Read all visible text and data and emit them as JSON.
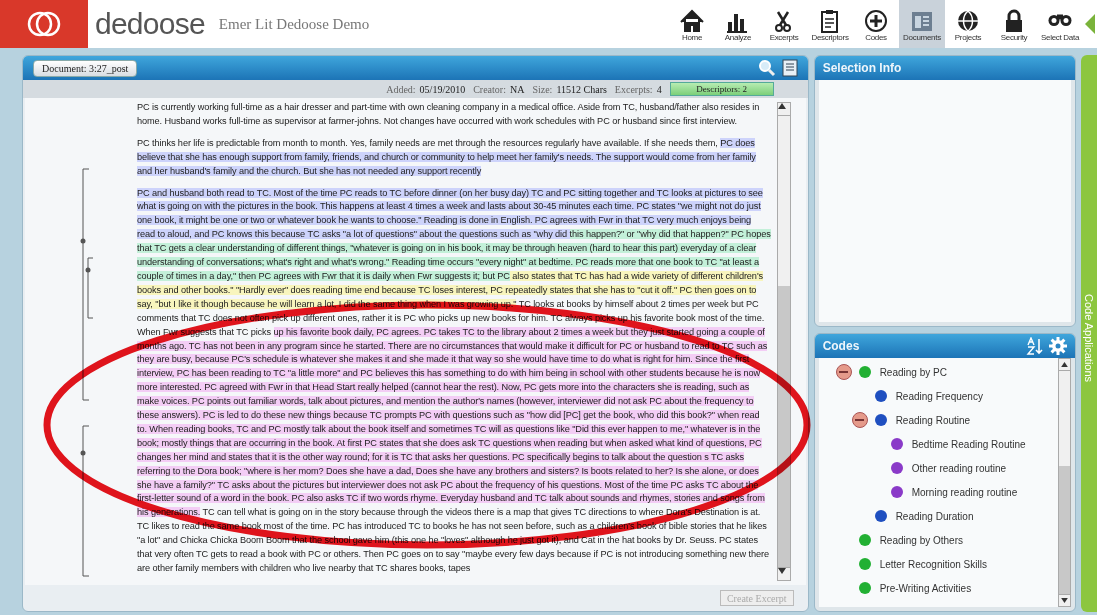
{
  "header": {
    "brand": "dedoose",
    "project": "Emer Lit Dedoose Demo",
    "toolbar": [
      {
        "label": "Home",
        "selected": false
      },
      {
        "label": "Analyze",
        "selected": false
      },
      {
        "label": "Excerpts",
        "selected": false
      },
      {
        "label": "Descriptors",
        "selected": false
      },
      {
        "label": "Codes",
        "selected": false
      },
      {
        "label": "Documents",
        "selected": true
      },
      {
        "label": "Projects",
        "selected": false
      },
      {
        "label": "Security",
        "selected": false
      },
      {
        "label": "Select Data",
        "selected": false
      }
    ]
  },
  "document": {
    "title_button": "Document: 3:27_post",
    "meta": [
      {
        "label": "Added:",
        "value": "05/19/2010"
      },
      {
        "label": "Creator:",
        "value": "NA"
      },
      {
        "label": "Size:",
        "value": "11512 Chars"
      },
      {
        "label": "Excerpts:",
        "value": "4"
      }
    ],
    "descriptors_button": "Descriptors: 2",
    "paragraphs": [
      {
        "runs": [
          {
            "text": "PC is currently working full-time as a hair dresser and part-time with own cleaning company in a medical office.  Aside from TC, husband/father also resides in home.  Husband works full-time as supervisor at farmer-johns.  Not changes have occurred with work schedules with PC or husband since first interview."
          }
        ]
      },
      {
        "runs": [
          {
            "text": "PC thinks her life is predictable from month to month.  Yes, family needs are met through the resources regularly have available.  If she needs them, "
          },
          {
            "text": "PC does believe that she has enough support from family, friends, and church or community to help meet her family's needs.  The support would come from her family and her husband's family and the church.  But she has not needed any support recently",
            "color": "#cdd3fb"
          }
        ]
      },
      {
        "runs": [
          {
            "text": "PC and husband both read to TC.  Most of the time PC reads to TC before dinner (on her busy day) TC and PC sitting together and TC looks at pictures to see what is going on with the pictures in the book.  This happens at least 4 times a week and lasts about 30-45 minutes each time. PC states \"we might not do just one book, it might be one or two or whatever book he wants to choose.\"  Reading is done in English.  PC agrees with Fwr in that TC very much enjoys being read to aloud, and PC knows this because TC asks \"a lot of questions\" about the questions such as \"why did ",
            "color": "#cdd3fb"
          },
          {
            "text": "this happen?\" or \"why did that happen?\"  PC hopes that TC gets a clear understanding of different things, \"whatever is going on in his book, it may be through heaven (hard to hear this part) everyday of a clear understanding of conversations; what's right and what's wrong.\"  Reading time occurs \"every night\" at bedtime.  PC reads more that one book to TC \"at least a couple of times in a day,\" then PC agrees with Fwr that it is daily when Fwr suggests it; but PC",
            "color": "#c3f0d9"
          },
          {
            "text": " also states that TC has had a wide variety of different children's books and other books.\"  \"Hardly ever\" does reading time end because TC loses interest, PC repeatedly states that she has to \"cut it off.\"  PC then goes on to say, \"but I like it though because he will learn a lot, I did the same thing when I was growing up.\"",
            "color": "#f8f5bd"
          },
          {
            "text": "  TC looks at books by himself about 2 times per week but PC comments that TC does not often pick up different ones, rather it is PC who picks up new books for him.  TC always picks up his favorite book most of the time.  When Fwr suggests that TC picks "
          },
          {
            "text": "up his favorite book daily, PC agrees.  PC takes TC to the library about 2 times a week but they just started going a couple of months ago.  TC has not been in any program since he started.  There are no circumstances that would make it difficult for PC or husband to read to TC such as they are busy, because PC's schedule is whatever she makes it and she made it that way so she would have time to do what is right for him.  Since the first interview, PC has been reading to TC \"a little more\" and PC believes this has something to do with him being in school with other students because he is now more interested. PC agreed with Fwr in that Head Start really helped (cannot hear the rest). Now, PC gets more into the characters she is reading, such as make voices.  PC points out familiar words, talk about pictures, and mention the author's names (however, interviewer did not ask PC about the frequency to these answers).  PC is led to do these new things because TC prompts PC with questions such as \"how did [PC] get the book, who did this book?\" when read to.  When reading books, TC and PC mostly talk about the book itself and sometimes TC will as questions like \"Did this ever happen to me,\" whatever is in the book; mostly things that are occurring in the book.  At first PC states that she does ask TC questions when reading but when asked what kind of questions, PC changes her mind and states that it is the other way round; for it is TC that asks her questions.  PC specifically begins to talk about the question s TC asks referring to the Dora book; \"where is her mom? Does she have a dad, Does she have any brothers and sisters?  Is boots related to her?  Is she alone, or does she have a family?\"  TC asks about the pictures but interviewer does not ask PC about the frequency of his questions.  Most of the time PC asks TC about the first-letter sound of a word in the book.  PC also asks TC if two words rhyme.  Everyday husband and TC talk about sounds and rhymes, stories and songs from his generations.",
            "color": "#f3cdf5"
          },
          {
            "text": "  TC can tell what is going on in the story because through the videos there is a map that gives TC directions to where Dora's Destination is at.  TC likes to read the same book most of the time.  PC has introduced TC to books he has not seen before, such as a children's book of bible stories that he likes \"a lot\" and Chicka Chicka Boom Boom that the school gave him (this one he \"loves\" although he just got it), and Cat in the hat books by Dr. Seuss.  PC states that very often TC gets to read a book with PC or others.  Then PC goes on to say \"maybe every few days because if PC is not introducing something new there are other family members with children who live nearby that TC shares books, tapes"
          }
        ]
      }
    ],
    "create_excerpt_button": {
      "label": "Create Excerpt",
      "disabled": true
    }
  },
  "selection_info": {
    "title": "Selection Info"
  },
  "codes": {
    "title": "Codes",
    "items": [
      {
        "label": "Reading by PC",
        "color": "#22b033",
        "expanded": true,
        "children": [
          {
            "label": "Reading Frequency",
            "color": "#1f4fc0"
          },
          {
            "label": "Reading Routine",
            "color": "#1f4fc0",
            "expanded": true,
            "children": [
              {
                "label": "Bedtime Reading Routine",
                "color": "#8a3ac8"
              },
              {
                "label": "Other reading routine",
                "color": "#8a3ac8"
              },
              {
                "label": "Morning reading routine",
                "color": "#8a3ac8"
              }
            ]
          },
          {
            "label": "Reading Duration",
            "color": "#1f4fc0"
          }
        ]
      },
      {
        "label": "Reading by Others",
        "color": "#22b033"
      },
      {
        "label": "Letter Recognition Skills",
        "color": "#22b033"
      },
      {
        "label": "Pre-Writing Activities",
        "color": "#22b033"
      }
    ]
  },
  "side_tab": {
    "label": "Code Applications"
  }
}
